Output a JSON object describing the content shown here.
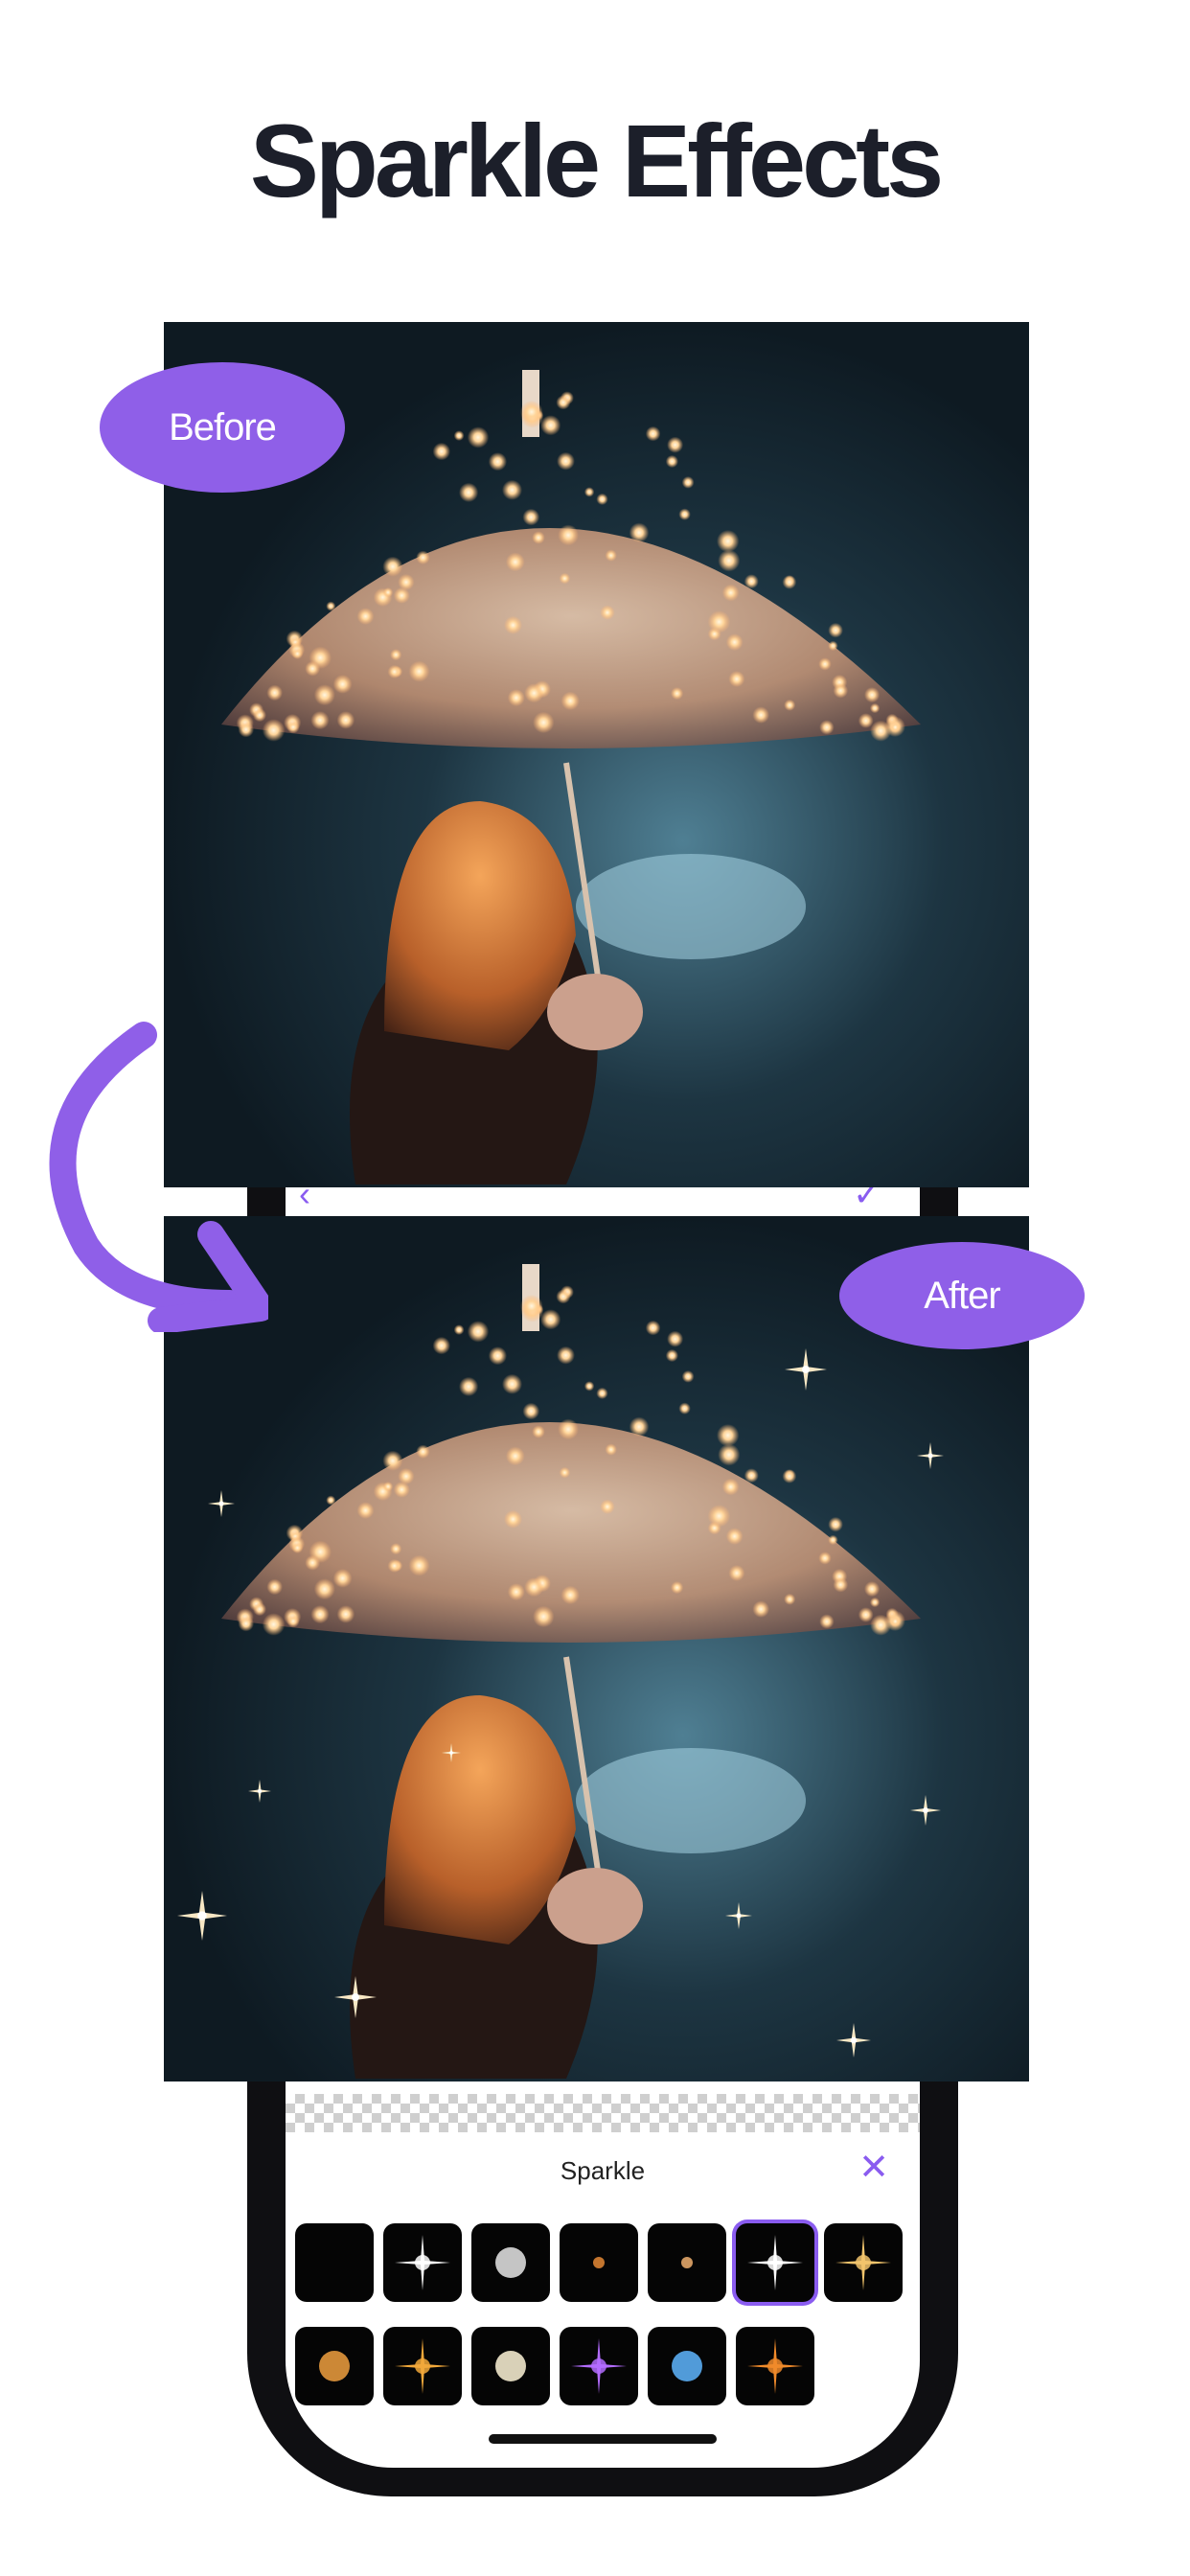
{
  "headline": "Sparkle Effects",
  "labels": {
    "before": "Before",
    "after": "After"
  },
  "editor": {
    "panel_title": "Sparkle",
    "close_glyph": "✕",
    "back_glyph": "‹",
    "confirm_glyph": "✓",
    "sparkle_presets": [
      {
        "icon": "sparkle-preset-none",
        "selected": false
      },
      {
        "icon": "sparkle-preset-white-star",
        "selected": false
      },
      {
        "icon": "sparkle-preset-soft-glow",
        "selected": false
      },
      {
        "icon": "sparkle-preset-orange-dot",
        "selected": false
      },
      {
        "icon": "sparkle-preset-small-dot",
        "selected": false
      },
      {
        "icon": "sparkle-preset-cross-star",
        "selected": true
      },
      {
        "icon": "sparkle-preset-gold-star",
        "selected": false
      },
      {
        "icon": "sparkle-preset-warm-flare",
        "selected": false
      },
      {
        "icon": "sparkle-preset-amber-star",
        "selected": false
      },
      {
        "icon": "sparkle-preset-bright-orb",
        "selected": false
      },
      {
        "icon": "sparkle-preset-purple-flare",
        "selected": false
      },
      {
        "icon": "sparkle-preset-blue-flare",
        "selected": false
      },
      {
        "icon": "sparkle-preset-orange-flare",
        "selected": false
      }
    ]
  },
  "colors": {
    "accent": "#8f5fe8",
    "headline": "#1c1f2a",
    "phone_frame": "#0f0f12"
  }
}
